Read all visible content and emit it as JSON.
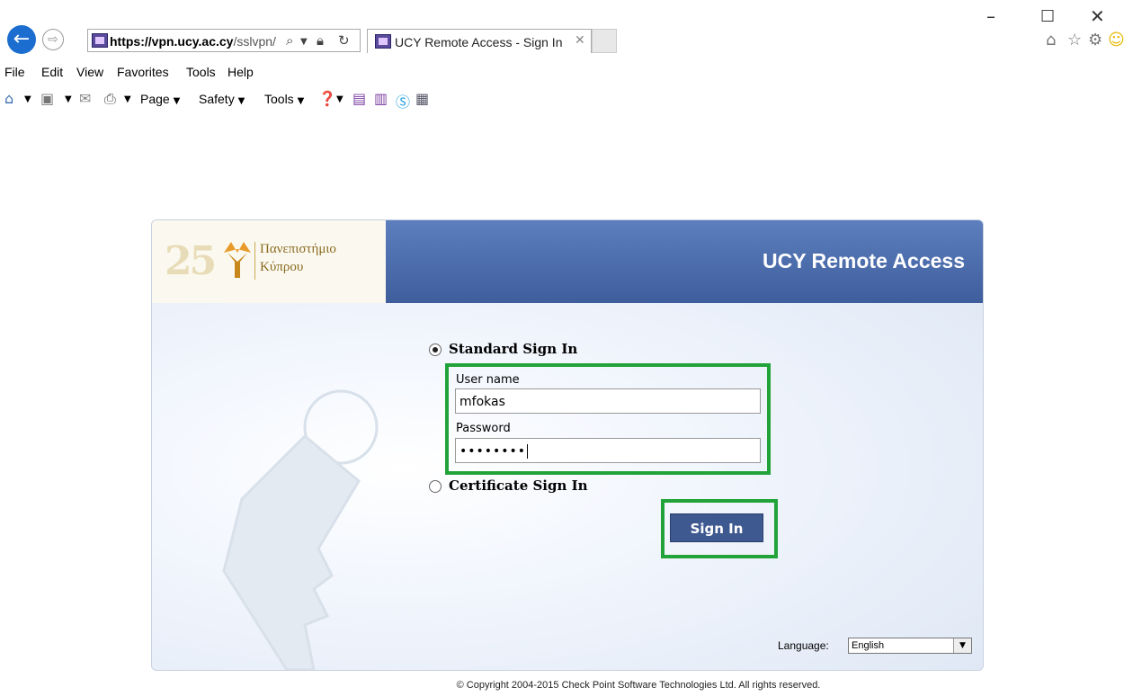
{
  "browser": {
    "url_domain": "https://vpn.ucy.ac.cy",
    "url_path": "/sslvpn/",
    "tab_title": "UCY Remote Access - Sign In",
    "menu": [
      "File",
      "Edit",
      "View",
      "Favorites",
      "Tools",
      "Help"
    ],
    "commands": {
      "page": "Page",
      "safety": "Safety",
      "tools": "Tools"
    },
    "icons": {
      "back": "back-arrow-icon",
      "forward": "forward-arrow-icon",
      "home": "home-icon",
      "favorites": "star-icon",
      "settings": "gear-icon",
      "smiley": "smiley-icon"
    }
  },
  "header": {
    "logo_line1": "Πανεπιστήμιο",
    "logo_line2": "Κύπρου",
    "logo_number": "25",
    "title": "UCY Remote Access"
  },
  "form": {
    "standard_label": "Standard Sign In",
    "standard_selected": true,
    "username_label": "User name",
    "username_value": "mfokas",
    "password_label": "Password",
    "password_value": "••••••••",
    "certificate_label": "Certificate Sign In",
    "signin_label": "Sign In"
  },
  "language": {
    "label": "Language:",
    "selected": "English"
  },
  "footer": {
    "copyright": "© Copyright 2004-2015   Check Point Software Technologies Ltd. All rights reserved."
  },
  "colors": {
    "header_blue": "#4a6aa8",
    "highlight_green": "#22a33a",
    "button_blue": "#3e5890"
  }
}
